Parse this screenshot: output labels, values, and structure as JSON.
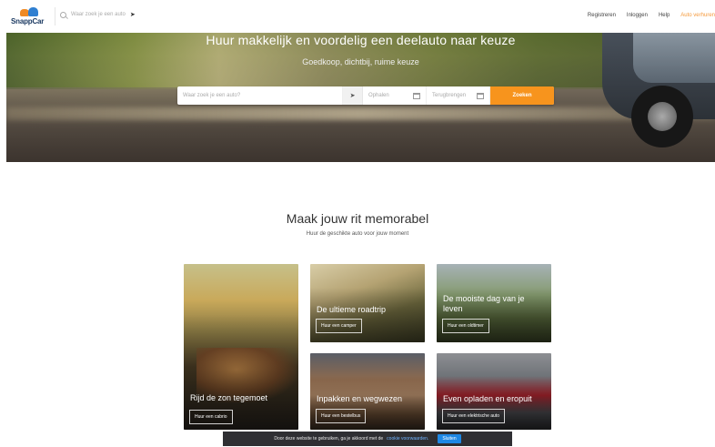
{
  "brand": {
    "name": "SnappCar",
    "colors": {
      "accent": "#f7941d",
      "brand_blue": "#2f7fd1",
      "brand_orange": "#f08a24"
    }
  },
  "topbar": {
    "search_placeholder": "Waar zoek je een auto",
    "nav": [
      {
        "label": "Registreren"
      },
      {
        "label": "Inloggen"
      },
      {
        "label": "Help"
      },
      {
        "label": "Auto verhuren"
      }
    ]
  },
  "hero": {
    "title": "Huur makkelijk en voordelig een deelauto naar keuze",
    "subtitle": "Goedkoop, dichtbij, ruime keuze",
    "search": {
      "where_placeholder": "Waar zoek je een auto?",
      "pickup_placeholder": "Ophalen",
      "return_placeholder": "Terugbrengen",
      "submit_label": "Zoeken"
    }
  },
  "section": {
    "title": "Maak jouw rit memorabel",
    "subtitle": "Huur de geschikte auto voor jouw moment"
  },
  "cards": [
    {
      "title": "Rijd de zon tegemoet",
      "button": "Huur een cabrio"
    },
    {
      "title": "De ultieme roadtrip",
      "button": "Huur een camper"
    },
    {
      "title": "De mooiste dag van je leven",
      "button": "Huur een oldtimer"
    },
    {
      "title": "Inpakken en wegwezen",
      "button": "Huur een bestelbus"
    },
    {
      "title": "Even opladen en eropuit",
      "button": "Huur een elektrische auto"
    }
  ],
  "cookie": {
    "text": "Door deze website te gebruiken, ga je akkoord met de",
    "link": "cookie voorwaarden.",
    "close": "Sluiten"
  }
}
